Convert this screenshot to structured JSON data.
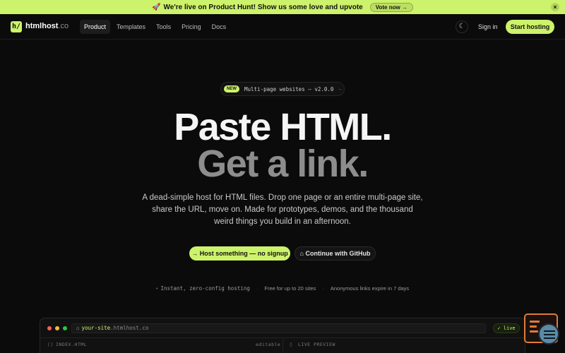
{
  "announcement": {
    "emoji": "🚀",
    "text": "We're live on Product Hunt! Show us some love and upvote",
    "cta": "Vote now →",
    "close": "×"
  },
  "nav": {
    "logo_mark": "h/",
    "brand": "htmlhost",
    "brand_tld": ".co",
    "links": [
      "Product",
      "Templates",
      "Tools",
      "Pricing",
      "Docs"
    ],
    "active_link": "Product",
    "theme_icon": "☾",
    "sign_in": "Sign in",
    "start": "Start hosting"
  },
  "hero": {
    "release_badge": "NEW",
    "release_text": "Multi-page websites — v2.0.0",
    "release_arrow": "→",
    "title_line1": "Paste HTML.",
    "title_line2": "Get a link.",
    "subtitle": "A dead-simple host for HTML files. Drop one page or an entire multi-page site, share the URL, move on. Made for prototypes, demos, and the thousand weird things you build in an afternoon.",
    "cta_primary": "Host something — no signup",
    "cta_primary_icon": "→",
    "cta_secondary": "Continue with GitHub",
    "cta_secondary_icon": "⌂"
  },
  "features": [
    "Instant, zero-config hosting",
    "Free for up to 20 sites",
    "Anonymous links expire in 7 days"
  ],
  "preview": {
    "url_subdomain": "your-site",
    "url_domain": ".htmlhost.co",
    "status": "✓ live",
    "left_pane": "INDEX.HTML",
    "left_pane_note": "editable",
    "right_pane": "LIVE PREVIEW"
  },
  "colors": {
    "accent": "#cdf26b",
    "background": "#0b0b0b",
    "muted_heading": "#8d8d8d"
  }
}
